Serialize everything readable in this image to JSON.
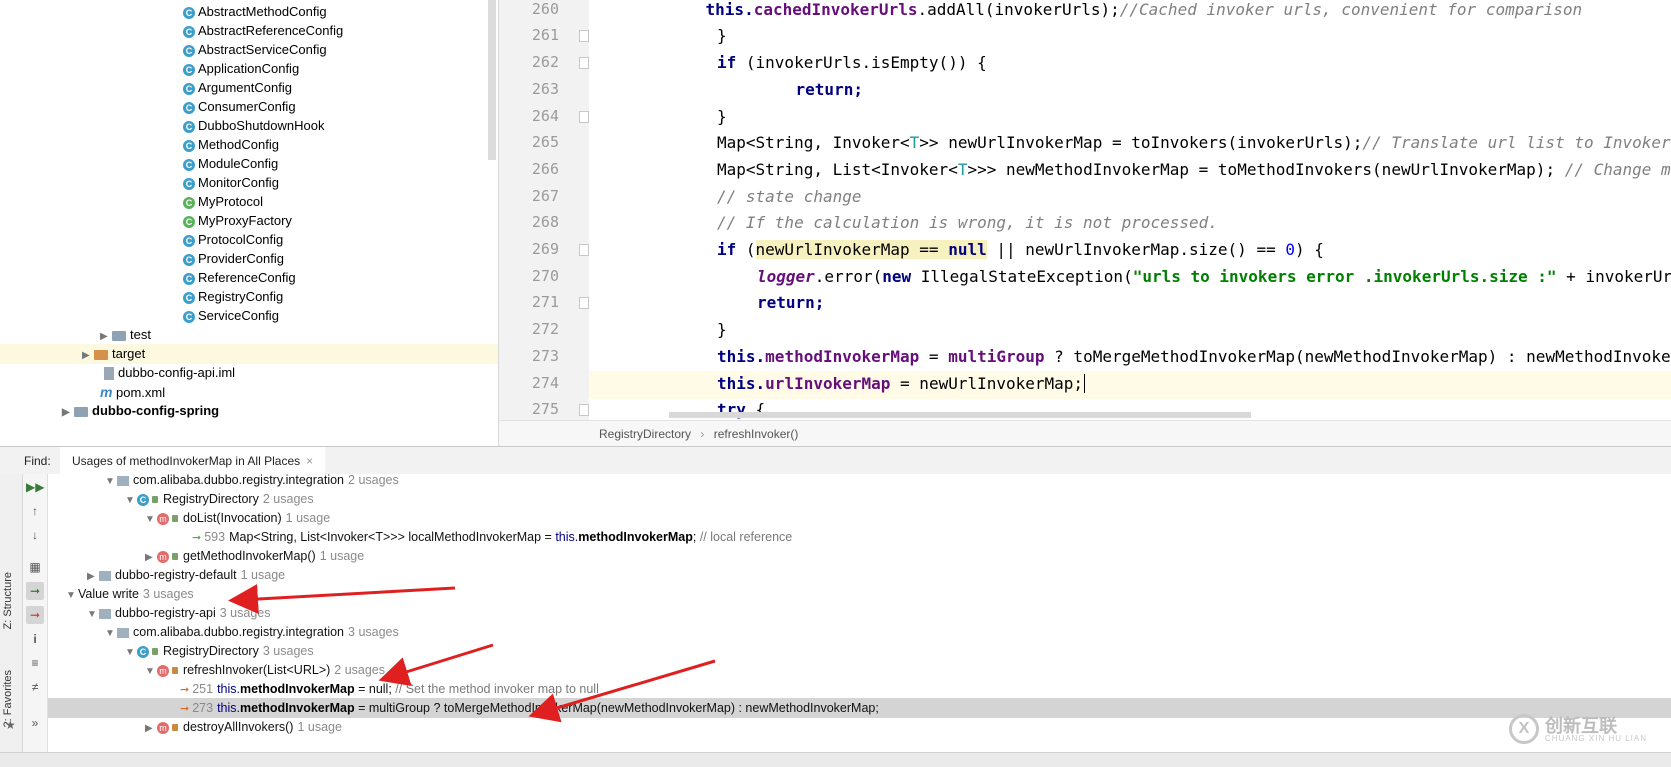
{
  "tree": {
    "items": [
      {
        "label": "AbstractMethodConfig",
        "icon": "class"
      },
      {
        "label": "AbstractReferenceConfig",
        "icon": "class"
      },
      {
        "label": "AbstractServiceConfig",
        "icon": "class"
      },
      {
        "label": "ApplicationConfig",
        "icon": "class"
      },
      {
        "label": "ArgumentConfig",
        "icon": "class"
      },
      {
        "label": "ConsumerConfig",
        "icon": "class"
      },
      {
        "label": "DubboShutdownHook",
        "icon": "class"
      },
      {
        "label": "MethodConfig",
        "icon": "class"
      },
      {
        "label": "ModuleConfig",
        "icon": "class"
      },
      {
        "label": "MonitorConfig",
        "icon": "class"
      },
      {
        "label": "MyProtocol",
        "icon": "class"
      },
      {
        "label": "MyProxyFactory",
        "icon": "class"
      },
      {
        "label": "ProtocolConfig",
        "icon": "class"
      },
      {
        "label": "ProviderConfig",
        "icon": "class"
      },
      {
        "label": "ReferenceConfig",
        "icon": "class"
      },
      {
        "label": "RegistryConfig",
        "icon": "class"
      },
      {
        "label": "ServiceConfig",
        "icon": "class"
      }
    ],
    "test": "test",
    "target": "target",
    "iml": "dubbo-config-api.iml",
    "pom": "pom.xml",
    "module": "dubbo-config-spring"
  },
  "editor": {
    "line_numbers": [
      "260",
      "261",
      "262",
      "263",
      "264",
      "265",
      "266",
      "267",
      "268",
      "269",
      "270",
      "271",
      "272",
      "273",
      "274",
      "275"
    ],
    "lines": {
      "l260a": "    this.",
      "l260b": "cachedInvokerUrls",
      "l260c": ".addAll(invokerUrls);",
      "l260d": "//Cached invoker urls, convenient for comparison",
      "l261": "}",
      "l262a": "if",
      "l262b": " (invokerUrls.isEmpty()) {",
      "l263": "    return;",
      "l264": "}",
      "l265a": "Map<String, Invoker<",
      "l265b": "T",
      "l265c": ">> newUrlInvokerMap = toInvokers(invokerUrls);",
      "l265d": "// Translate url list to Invoker map",
      "l266a": "Map<String, List<Invoker<",
      "l266b": "T",
      "l266c": ">>> newMethodInvokerMap = toMethodInvokers(newUrlInvokerMap); ",
      "l266d": "// Change method name to map Invoker Map",
      "l267": "// state change",
      "l268": "// If the calculation is wrong, it is not processed.",
      "l269a": "if",
      "l269b": " (",
      "l269c": "newUrlInvokerMap == ",
      "l269d": "null",
      "l269e": " || newUrlInvokerMap.size() == ",
      "l269f": "0",
      "l269g": ") {",
      "l270a": "logger",
      "l270b": ".error(",
      "l270c": "new",
      "l270d": " IllegalStateException(",
      "l270e": "\"urls to invokers error .invokerUrls.size :\"",
      "l270f": " + invokerUrls.size()",
      "l271": "return;",
      "l272": "}",
      "l273a": "this.",
      "l273b": "methodInvokerMap",
      "l273c": " = ",
      "l273d": "multiGroup",
      "l273e": " ? toMergeMethodInvokerMap(newMethodInvokerMap) : newMethodInvokerMap;",
      "l274a": "this.",
      "l274b": "urlInvokerMap",
      "l274c": " = newUrlInvokerMap;",
      "l275a": "try",
      "l275b": " {"
    },
    "breadcrumb": [
      "RegistryDirectory",
      "refreshInvoker()"
    ]
  },
  "find": {
    "label": "Find:",
    "tab": "Usages of methodInvokerMap in All Places"
  },
  "side_tabs": [
    "Z: Structure",
    "2: Favorites"
  ],
  "results": {
    "r1": {
      "label": "com.alibaba.dubbo.registry.integration",
      "count": "2 usages"
    },
    "r2": {
      "label": "RegistryDirectory",
      "count": "2 usages"
    },
    "r3": {
      "label": "doList(Invocation)",
      "count": "1 usage"
    },
    "r4": {
      "line": "593",
      "pre": "Map<String, List<Invoker<T>>> localMethodInvokerMap = ",
      "this": "this.",
      "bold": "methodInvokerMap",
      "post": "; ",
      "comment": "// local reference"
    },
    "r5": {
      "label": "getMethodInvokerMap()",
      "count": "1 usage"
    },
    "r6": {
      "label": "dubbo-registry-default",
      "count": "1 usage"
    },
    "r7": {
      "label": "Value write",
      "count": "3 usages"
    },
    "r8": {
      "label": "dubbo-registry-api",
      "count": "3 usages"
    },
    "r9": {
      "label": "com.alibaba.dubbo.registry.integration",
      "count": "3 usages"
    },
    "r10": {
      "label": "RegistryDirectory",
      "count": "3 usages"
    },
    "r11": {
      "label": "refreshInvoker(List<URL>)",
      "count": "2 usages"
    },
    "r12": {
      "line": "251",
      "this": "this.",
      "bold": "methodInvokerMap",
      "post": " = null; ",
      "comment": "// Set the method invoker map to null"
    },
    "r13": {
      "line": "273",
      "this": "this.",
      "bold": "methodInvokerMap",
      "post": " = multiGroup ? toMergeMethodInvokerMap(newMethodInvokerMap) : newMethodInvokerMap;"
    },
    "r14": {
      "label": "destroyAllInvokers()",
      "count": "1 usage"
    }
  },
  "watermark": {
    "cn": "创新互联",
    "en": "CHUANG XIN HU LIAN",
    "logo": "X"
  },
  "colors": {
    "arrow": "#e02020",
    "keyword": "#000080",
    "field": "#660e7a",
    "comment": "#808080",
    "string": "#008000"
  }
}
